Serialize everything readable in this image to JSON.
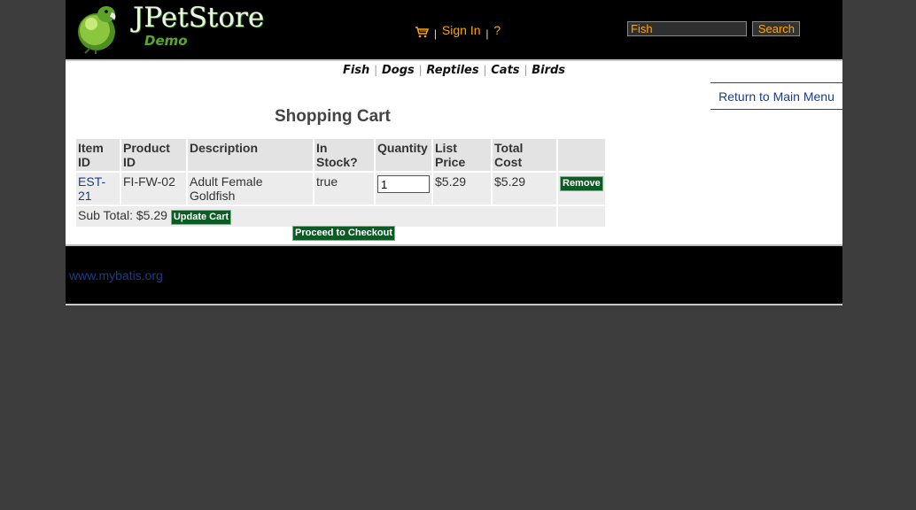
{
  "header": {
    "logo_title": "JPetStore",
    "logo_subtitle": "Demo",
    "sign_in": "Sign In",
    "help": "?",
    "separator": "|",
    "search_value": "Fish",
    "search_button": "Search"
  },
  "quicklinks": [
    "Fish",
    "Dogs",
    "Reptiles",
    "Cats",
    "Birds"
  ],
  "content": {
    "back_link": "Return to Main Menu",
    "heading": "Shopping Cart",
    "columns": [
      "Item ID",
      "Product ID",
      "Description",
      "In Stock?",
      "Quantity",
      "List Price",
      "Total Cost"
    ],
    "rows": [
      {
        "item_id": "EST-21",
        "product_id": "FI-FW-02",
        "description": "Adult Female Goldfish",
        "in_stock": "true",
        "quantity": "1",
        "list_price": "$5.29",
        "total_cost": "$5.29",
        "remove_label": "Remove"
      }
    ],
    "subtotal_label": "Sub Total: $5.29",
    "update_cart": "Update Cart",
    "checkout": "Proceed to Checkout"
  },
  "footer": {
    "link": "www.mybatis.org"
  },
  "colors": {
    "background": "#3d3d3d",
    "header": "#000000",
    "menu_orange": "#ffa500",
    "link_blue": "#1a3d8c",
    "button_green": "#0c5a24"
  }
}
